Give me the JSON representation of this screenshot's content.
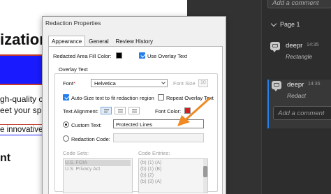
{
  "document": {
    "heading_fragment": "ization",
    "line1": "gh-quality con",
    "line2": "eet your spec",
    "line3": "e innovative t",
    "line4": "nt"
  },
  "comments_panel": {
    "add_comment_top": "Add a comment",
    "page_label": "Page 1",
    "comments": [
      {
        "author": "deepr",
        "time": "14:35",
        "type": "Rectangle"
      },
      {
        "author": "deepr",
        "time": "14:35",
        "type": "Redact"
      }
    ],
    "add_comment_reply": "Add a comment"
  },
  "dialog": {
    "title": "Redaction Properties",
    "tabs": [
      {
        "label": "Appearance",
        "active": true
      },
      {
        "label": "General",
        "active": false
      },
      {
        "label": "Review History",
        "active": false
      }
    ],
    "fill_color_label": "Redacted Area Fill Color:",
    "fill_color": "#000000",
    "use_overlay_label": "Use Overlay Text",
    "overlay_group_label": "Overlay Text",
    "font_label": "Font",
    "font_required_mark": "*",
    "font_value": "Helvetica",
    "font_size_label": "Font Size",
    "font_size_value": "10",
    "autosize_label": "Auto-Size text to fit redaction region",
    "repeat_label": "Repeat Overlay Text",
    "text_alignment_label": "Text Alignment:",
    "font_color_label": "Font Color:",
    "font_color": "#d42020",
    "custom_text_label": "Custom Text:",
    "custom_text_value": "Protected Lines",
    "redaction_code_label": "Redaction Code:",
    "code_sets_label": "Code Sets:",
    "code_entries_label": "Code Entries:",
    "code_sets": [
      "U.S. FOIA",
      "U.S. Privacy Act"
    ],
    "code_entries": [
      "(b) (1) (A)",
      "(b) (1) (B)",
      "(b) (2)",
      "(b) (3) (A)"
    ]
  },
  "colors": {
    "accent": "#2680eb",
    "annotation_arrow": "#f08a24",
    "panel_bg": "#2d2d2d"
  }
}
